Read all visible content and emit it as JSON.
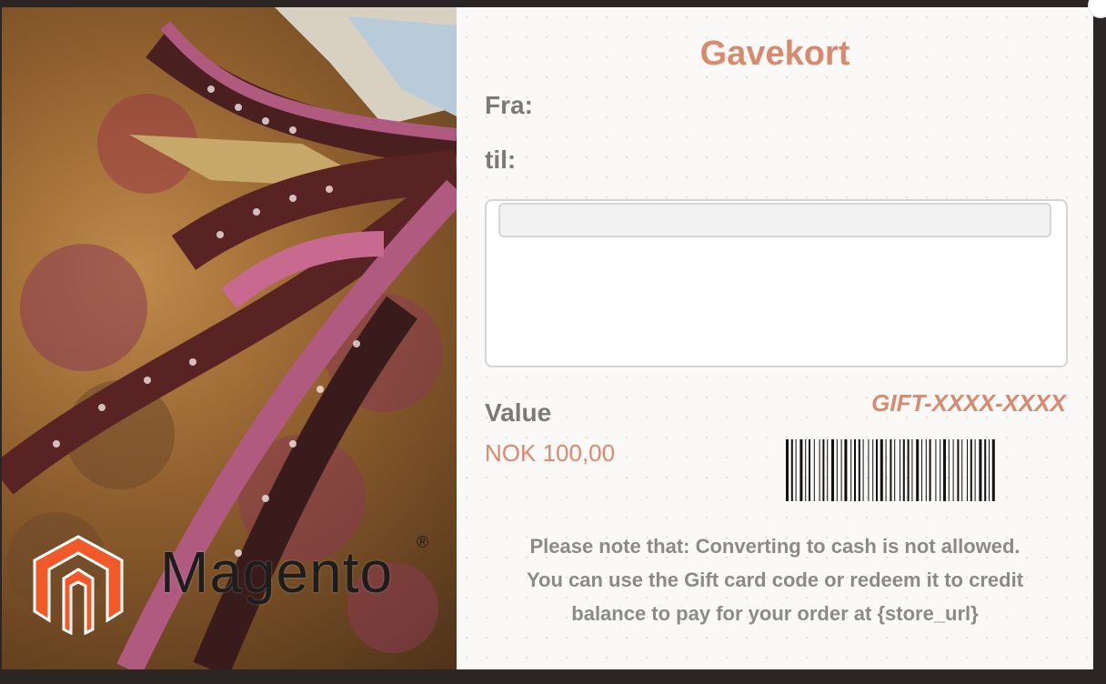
{
  "card": {
    "title": "Gavekort",
    "from_label": "Fra:",
    "to_label": "til:",
    "value_label": "Value",
    "value_amount": "NOK 100,00",
    "gift_code": "GIFT-XXXX-XXXX",
    "note_lines": [
      "Please note that: Converting to cash is not allowed.",
      "You can use the Gift card code or redeem it to credit",
      "balance to pay for your order at {store_url}"
    ]
  },
  "photo": {
    "logo_text": "Magento",
    "logo_mark": "®"
  },
  "colors": {
    "accent": "#d9896d",
    "label": "#7a7a7a",
    "logo_red": "#f05a28"
  }
}
